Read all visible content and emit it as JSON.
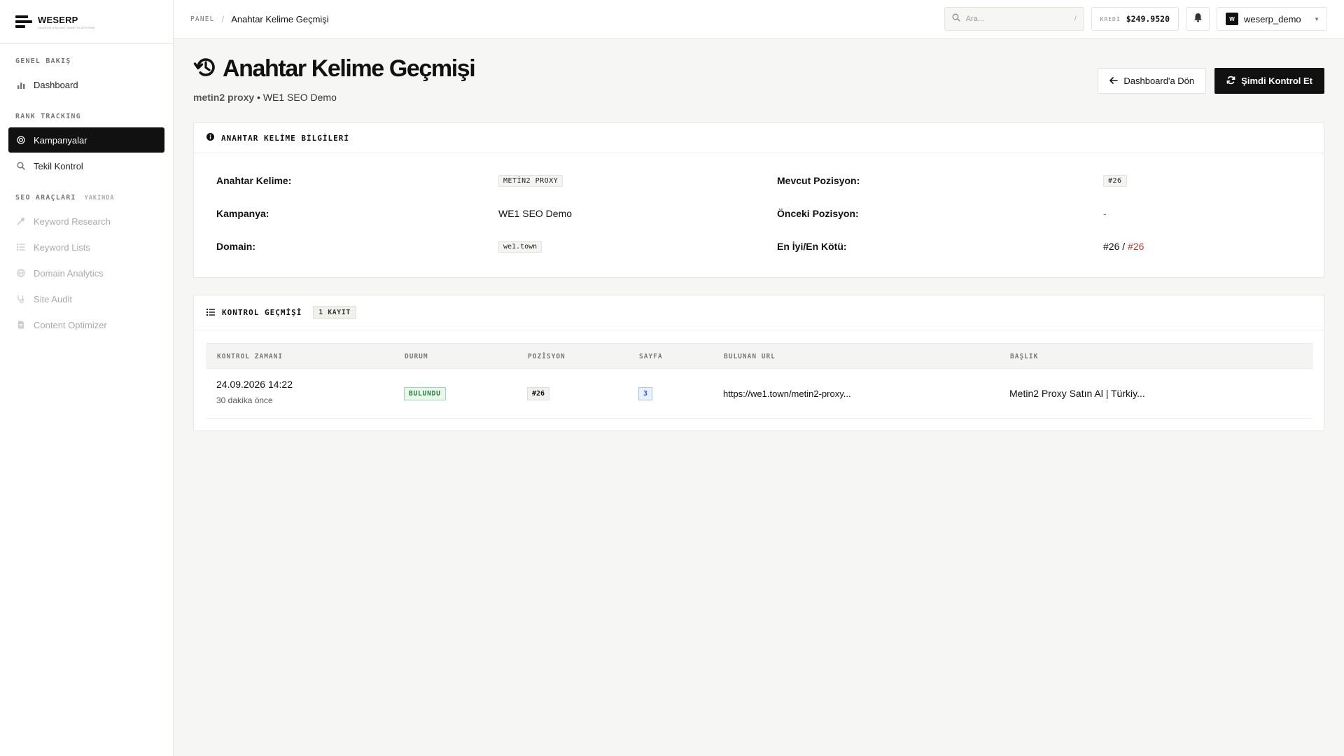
{
  "brand": {
    "name": "WESERP",
    "tagline": "SEARCH ENGINE RANK PLATFORM"
  },
  "sidebar": {
    "sections": [
      {
        "title": "GENEL BAKIŞ",
        "items": [
          {
            "label": "Dashboard",
            "icon": "bar-chart-icon"
          }
        ]
      },
      {
        "title": "RANK TRACKING",
        "items": [
          {
            "label": "Kampanyalar",
            "icon": "target-icon",
            "active": true
          },
          {
            "label": "Tekil Kontrol",
            "icon": "search-icon"
          }
        ]
      },
      {
        "title": "SEO ARAÇLARI",
        "badge": "YAKINDA",
        "items": [
          {
            "label": "Keyword Research",
            "icon": "key-icon"
          },
          {
            "label": "Keyword Lists",
            "icon": "list-icon"
          },
          {
            "label": "Domain Analytics",
            "icon": "globe-icon"
          },
          {
            "label": "Site Audit",
            "icon": "stethoscope-icon"
          },
          {
            "label": "Content Optimizer",
            "icon": "document-icon"
          }
        ]
      }
    ]
  },
  "topbar": {
    "breadcrumb": {
      "root": "PANEL",
      "separator": "/",
      "current": "Anahtar Kelime Geçmişi"
    },
    "search": {
      "placeholder": "Ara...",
      "shortcut": "/"
    },
    "credit": {
      "label": "KREDİ",
      "value": "$249.9520"
    },
    "user": {
      "initial": "W",
      "name": "weserp_demo"
    }
  },
  "page": {
    "title": "Anahtar Kelime Geçmişi",
    "subtitle_keyword": "metin2 proxy",
    "subtitle_sep": "•",
    "subtitle_campaign": "WE1 SEO Demo",
    "buttons": {
      "back": "Dashboard'a Dön",
      "check": "Şimdi Kontrol Et"
    }
  },
  "info": {
    "heading": "ANAHTAR KELİME BİLGİLERİ",
    "keyword_label": "Anahtar Kelime:",
    "keyword_value": "METİN2 PROXY",
    "campaign_label": "Kampanya:",
    "campaign_value": "WE1 SEO Demo",
    "domain_label": "Domain:",
    "domain_value": "we1.town",
    "current_label": "Mevcut Pozisyon:",
    "current_value": "#26",
    "previous_label": "Önceki Pozisyon:",
    "previous_value": "-",
    "bestworst_label": "En İyi/En Kötü:",
    "best_value": "#26",
    "bestworst_sep": "/",
    "worst_value": "#26"
  },
  "history": {
    "heading": "KONTROL GEÇMİŞİ",
    "count": "1 KAYIT",
    "columns": [
      "KONTROL ZAMANI",
      "DURUM",
      "POZİSYON",
      "SAYFA",
      "BULUNAN URL",
      "BAŞLIK"
    ],
    "rows": [
      {
        "time": "24.09.2026 14:22",
        "relative": "30 dakika önce",
        "status": "BULUNDU",
        "position": "#26",
        "page": "3",
        "url": "https://we1.town/metin2-proxy...",
        "title": "Metin2 Proxy Satın Al | Türkiy..."
      }
    ]
  },
  "colors": {
    "accent": "#111111",
    "success": "#1e7d3a",
    "danger": "#c0392b",
    "info": "#1d4ed8"
  }
}
